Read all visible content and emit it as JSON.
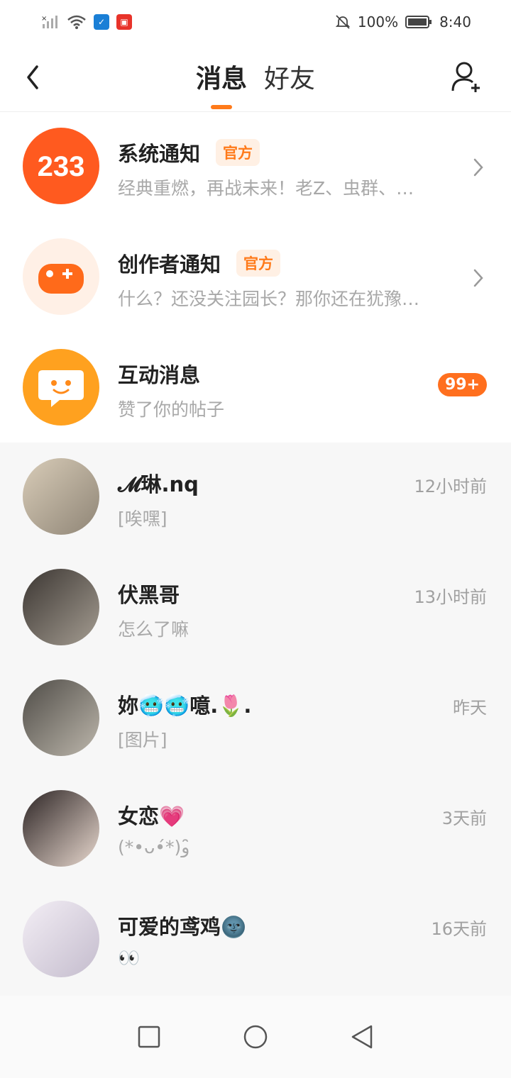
{
  "status_bar": {
    "battery": "100%",
    "time": "8:40",
    "left_icons": [
      "signal-off-icon",
      "wifi-icon",
      "shield-app-icon",
      "app-notification-icon"
    ],
    "right_icons": [
      "bell-muted-icon",
      "battery-icon"
    ]
  },
  "header": {
    "tabs": [
      {
        "label": "消息",
        "active": true
      },
      {
        "label": "好友",
        "active": false
      }
    ]
  },
  "official": [
    {
      "title": "系统通知",
      "tag": "官方",
      "preview": "经典重燃，再战未来！老Z、虫群、…",
      "avatar_text": "233",
      "avatar_color": "#ff5a1f"
    },
    {
      "title": "创作者通知",
      "tag": "官方",
      "preview": "什么？还没关注园长？那你还在犹豫…",
      "avatar_color": "#fff0e6",
      "icon_color": "#ff6a1a"
    },
    {
      "title": "互动消息",
      "preview": "赞了你的帖子",
      "badge": "99+",
      "avatar_color": "#ffa11f"
    }
  ],
  "chats": [
    {
      "name": "𝓜琳.nq",
      "preview": "[唉嘿]",
      "time": "12小时前",
      "avatar_color": "#b7a894"
    },
    {
      "name": "伏黑哥",
      "preview": "怎么了嘛",
      "time": "13小时前",
      "avatar_color": "#5a534c"
    },
    {
      "name": "妳🥶🥶噫.🌷.",
      "preview": "[图片]",
      "time": "昨天",
      "avatar_color": "#7d7a74"
    },
    {
      "name": "女恋💗",
      "preview": "(*•ᴗ•́*)و ̑̑",
      "time": "3天前",
      "avatar_color": "#c9b7ad"
    },
    {
      "name": "可爱的鸢鸡🌚",
      "preview": "👀",
      "time": "16天前",
      "avatar_color": "#dcd6e3"
    }
  ],
  "colors": {
    "accent": "#ff7a1a",
    "chat_bg": "#f7f7f7"
  }
}
